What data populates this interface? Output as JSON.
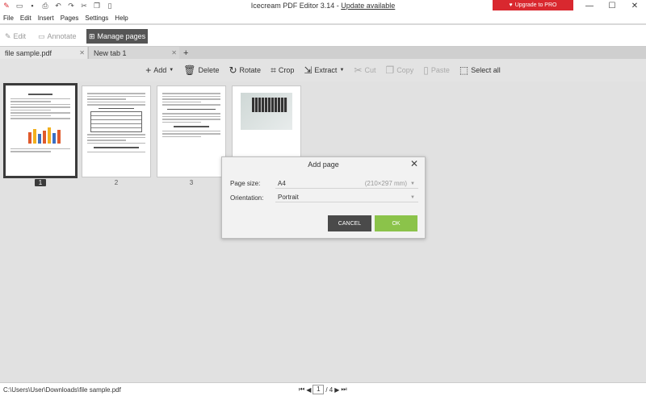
{
  "window": {
    "title": "Icecream PDF Editor 3.14 - ",
    "update_link": "Update available",
    "upgrade_label": "Upgrade to PRO",
    "minimize": "—",
    "maximize": "☐",
    "close": "✕"
  },
  "menu": [
    "File",
    "Edit",
    "Insert",
    "Pages",
    "Settings",
    "Help"
  ],
  "modes": {
    "edit": "Edit",
    "annotate": "Annotate",
    "manage": "Manage pages"
  },
  "tabs": {
    "file": "file sample.pdf",
    "new": "New tab 1",
    "add": "+"
  },
  "toolbar": {
    "add": "Add",
    "delete": "Delete",
    "rotate": "Rotate",
    "crop": "Crop",
    "extract": "Extract",
    "cut": "Cut",
    "copy": "Copy",
    "paste": "Paste",
    "select_all": "Select all"
  },
  "page_numbers": [
    "1",
    "2",
    "3"
  ],
  "dialog": {
    "title": "Add page",
    "page_size_label": "Page size:",
    "page_size_value": "A4",
    "page_size_dims": "(210×297 mm)",
    "orientation_label": "Orientation:",
    "orientation_value": "Portrait",
    "cancel": "CANCEL",
    "ok": "OK"
  },
  "status": {
    "path": "C:\\Users\\User\\Downloads\\file sample.pdf",
    "current_page": "1",
    "total": "/ 4"
  },
  "colors": {
    "upgrade": "#d9282f",
    "active_mode": "#555555",
    "cancel_btn": "#4a4a4a",
    "ok_btn": "#8bc34a"
  }
}
